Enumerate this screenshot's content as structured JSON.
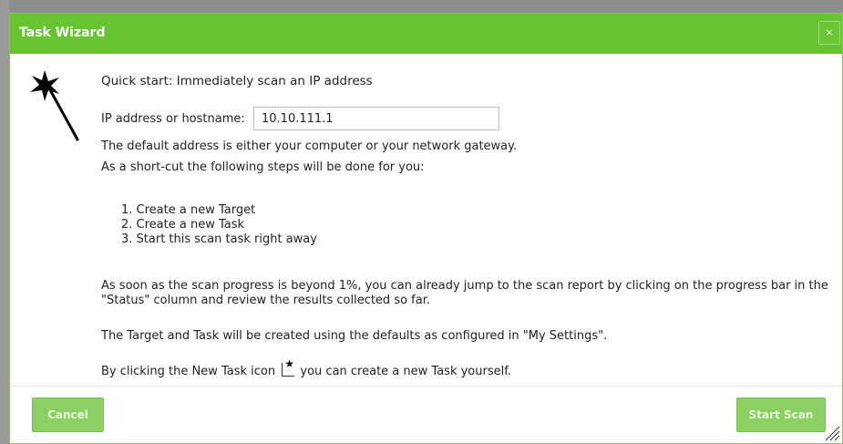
{
  "dialog": {
    "title": "Task Wizard",
    "close_label": "×"
  },
  "content": {
    "heading": "Quick start: Immediately scan an IP address",
    "ip_label": "IP address or hostname:",
    "ip_value": "10.10.111.1",
    "default_note": "The default address is either your computer or your network gateway.",
    "shortcut_note": "As a short-cut the following steps will be done for you:",
    "steps": [
      "1. Create a new Target",
      "2. Create a new Task",
      "3. Start this scan task right away"
    ],
    "progress_note": "As soon as the scan progress is beyond 1%, you can already jump to the scan report by clicking on the progress bar in the \"Status\" column and review the results collected so far.",
    "defaults_note": "The Target and Task will be created using the defaults as configured in \"My Settings\".",
    "new_task_prefix": "By clicking the New Task icon",
    "new_task_suffix": "you can create a new Task yourself."
  },
  "footer": {
    "cancel_label": "Cancel",
    "start_label": "Start Scan"
  },
  "colors": {
    "titlebar": "#66c430",
    "button": "#8ccf63"
  },
  "icons": {
    "wizard": "magic-wand-icon",
    "new_task": "new-task-icon",
    "close": "close-icon",
    "resize": "resize-handle-icon"
  }
}
